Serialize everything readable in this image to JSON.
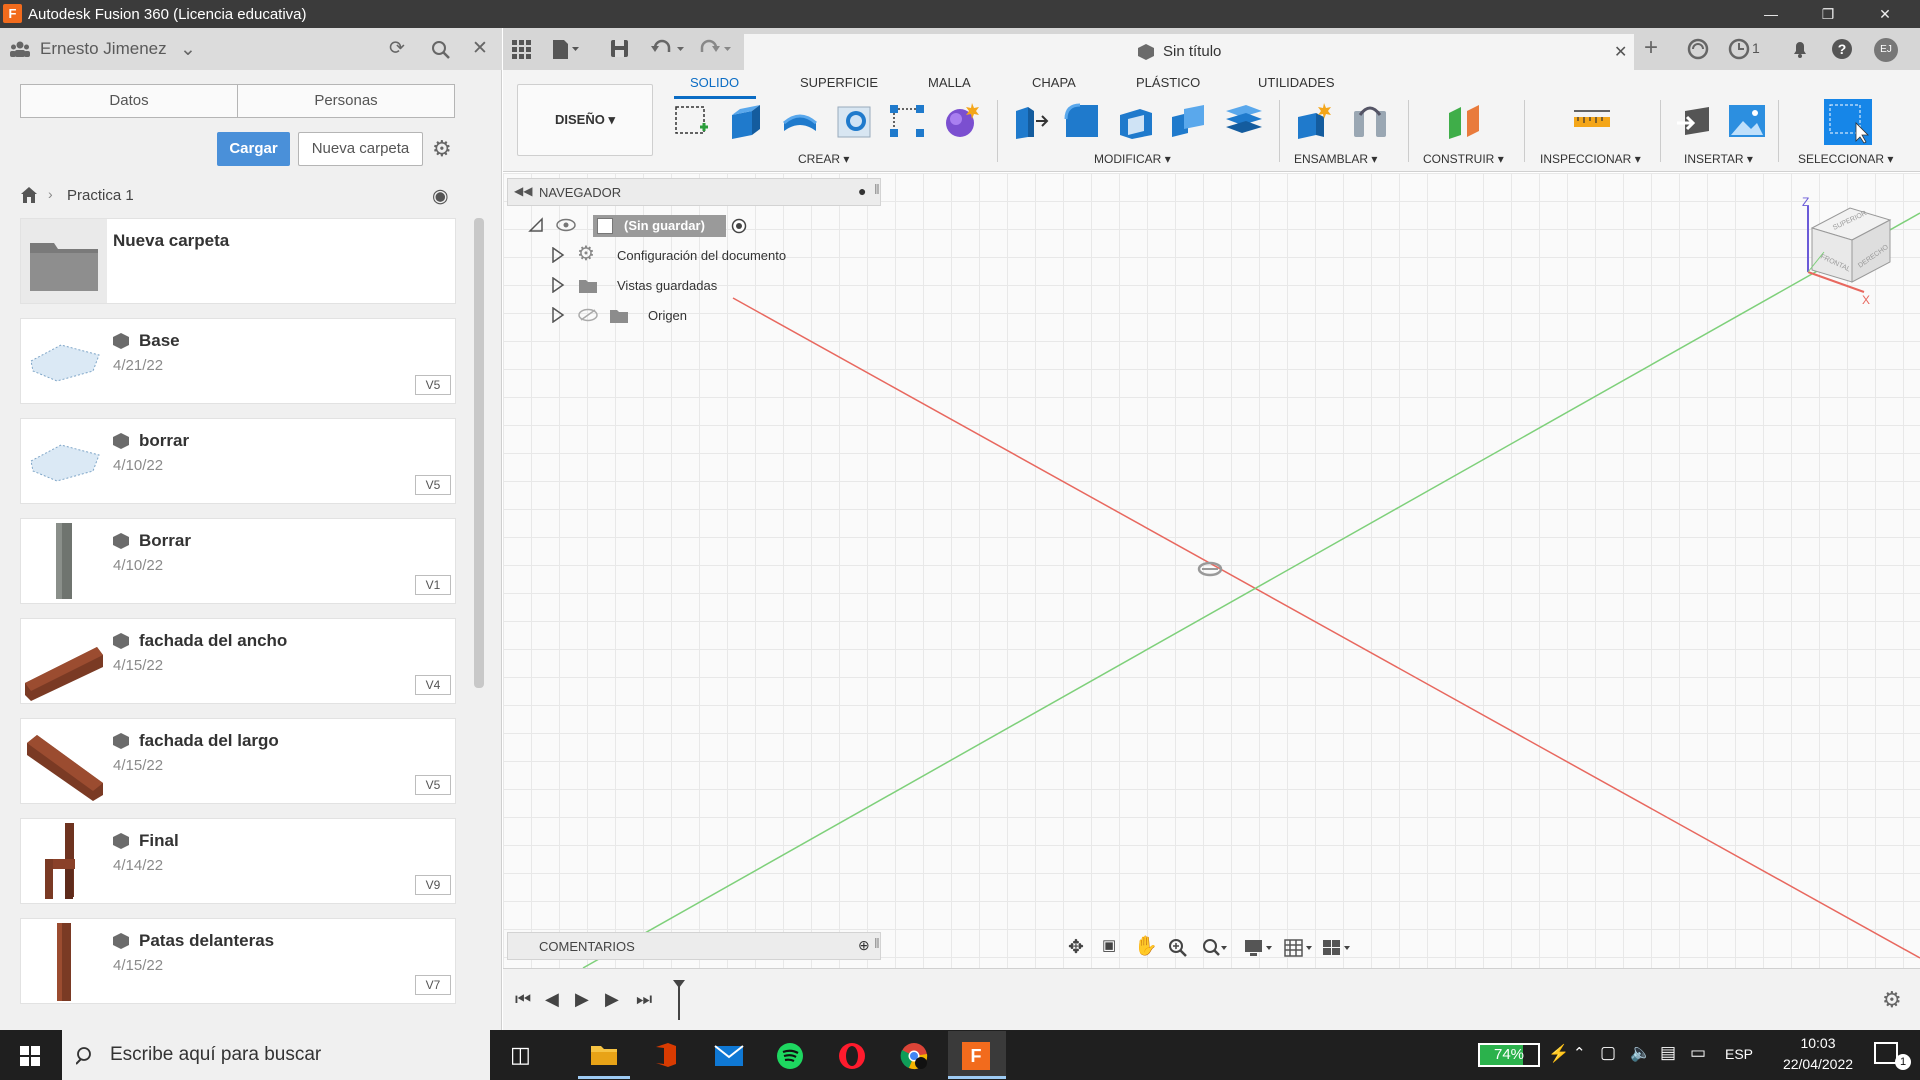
{
  "window": {
    "title": "Autodesk Fusion 360 (Licencia educativa)",
    "app_icon": "F"
  },
  "data_panel": {
    "user": "Ernesto Jimenez",
    "tabs": [
      "Datos",
      "Personas"
    ],
    "upload_label": "Cargar",
    "new_folder_label": "Nueva carpeta",
    "breadcrumb": "Practica 1",
    "items": [
      {
        "name": "Nueva carpeta",
        "date": "",
        "version": ""
      },
      {
        "name": "Base",
        "date": "4/21/22",
        "version": "V5"
      },
      {
        "name": "borrar",
        "date": "4/10/22",
        "version": "V5"
      },
      {
        "name": "Borrar",
        "date": "4/10/22",
        "version": "V1"
      },
      {
        "name": "fachada del ancho",
        "date": "4/15/22",
        "version": "V4"
      },
      {
        "name": "fachada del largo",
        "date": "4/15/22",
        "version": "V5"
      },
      {
        "name": "Final",
        "date": "4/14/22",
        "version": "V9"
      },
      {
        "name": "Patas delanteras",
        "date": "4/15/22",
        "version": "V7"
      }
    ]
  },
  "document_tab": {
    "title": "Sin título",
    "jobs_count": "1",
    "user_initials": "EJ"
  },
  "toolbar": {
    "workspace": "DISEÑO",
    "tabs": [
      "SOLIDO",
      "SUPERFICIE",
      "MALLA",
      "CHAPA",
      "PLÁSTICO",
      "UTILIDADES"
    ],
    "active_tab": "SOLIDO",
    "groups": [
      "CREAR",
      "MODIFICAR",
      "ENSAMBLAR",
      "CONSTRUIR",
      "INSPECCIONAR",
      "INSERTAR",
      "SELECCIONAR"
    ]
  },
  "browser": {
    "title": "NAVEGADOR",
    "root": "(Sin guardar)",
    "nodes": [
      "Configuración del documento",
      "Vistas guardadas",
      "Origen"
    ]
  },
  "viewcube": {
    "faces": [
      "SUPERIOR",
      "FRONTAL",
      "DERECHO"
    ],
    "axes": [
      "Z",
      "X"
    ]
  },
  "comments": {
    "title": "COMENTARIOS"
  },
  "taskbar": {
    "search_placeholder": "Escribe aquí para buscar",
    "battery": "74%",
    "language": "ESP",
    "time": "10:03",
    "date": "22/04/2022",
    "notifications": "1"
  },
  "colors": {
    "accent": "#0a6cc4",
    "upload_button": "#4a90d9",
    "axis_red": "#e8685f",
    "axis_green": "#7ed07a",
    "app_orange": "#f26b1d"
  }
}
